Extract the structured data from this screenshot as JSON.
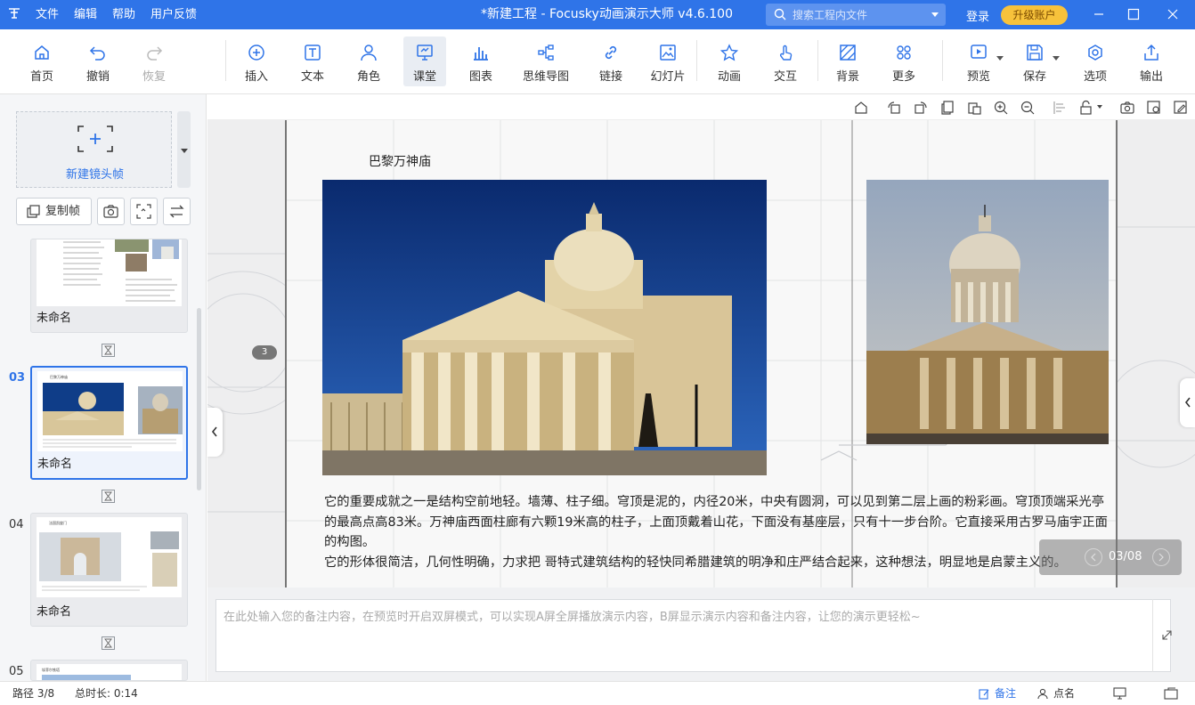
{
  "titlebar": {
    "menus": [
      "文件",
      "编辑",
      "帮助",
      "用户反馈"
    ],
    "title": "*新建工程 - Focusky动画演示大师  v4.6.100",
    "search_placeholder": "搜索工程内文件",
    "login": "登录",
    "upgrade": "升级账户",
    "brand_color": "#2f74e8"
  },
  "toolbar": {
    "home": "首页",
    "undo": "撤销",
    "redo": "恢复",
    "insert": "插入",
    "text": "文本",
    "role": "角色",
    "classroom": "课堂",
    "chart": "图表",
    "mindmap": "思维导图",
    "link": "链接",
    "slide": "幻灯片",
    "animation": "动画",
    "interaction": "交互",
    "background": "背景",
    "more": "更多",
    "preview": "预览",
    "save": "保存",
    "options": "选项",
    "export": "输出"
  },
  "leftpanel": {
    "new_frame": "新建镜头帧",
    "copy_frame": "复制帧",
    "frames": [
      {
        "number": "",
        "name": "未命名"
      },
      {
        "number": "03",
        "name": "未命名",
        "selected": true
      },
      {
        "number": "04",
        "name": "未命名"
      },
      {
        "number": "05",
        "name": ""
      }
    ]
  },
  "slide": {
    "title": "巴黎万神庙",
    "paragraph1": "它的重要成就之一是结构空前地轻。墙薄、柱子细。穹顶是泥的，内径20米，中央有圆洞，可以见到第二层上画的粉彩画。穹顶顶端采光亭的最高点高83米。万神庙西面柱廊有六颗19米高的柱子，上面顶戴着山花，下面没有基座层，只有十一步台阶。它直接采用古罗马庙宇正面的构图。",
    "paragraph2": "它的形体很简洁，几何性明确，力求把 哥特式建筑结构的轻快同希腊建筑的明净和庄严结合起来，这种想法，明显地是启蒙主义的。",
    "badge": "3",
    "page_nav": "03/08"
  },
  "notes": {
    "placeholder": "在此处输入您的备注内容，在预览时开启双屏模式，可以实现A屏全屏播放演示内容，B屏显示演示内容和备注内容，让您的演示更轻松~"
  },
  "statusbar": {
    "path": "路径 3/8",
    "duration": "总时长: 0:14",
    "notes": "备注",
    "rollcall": "点名"
  }
}
